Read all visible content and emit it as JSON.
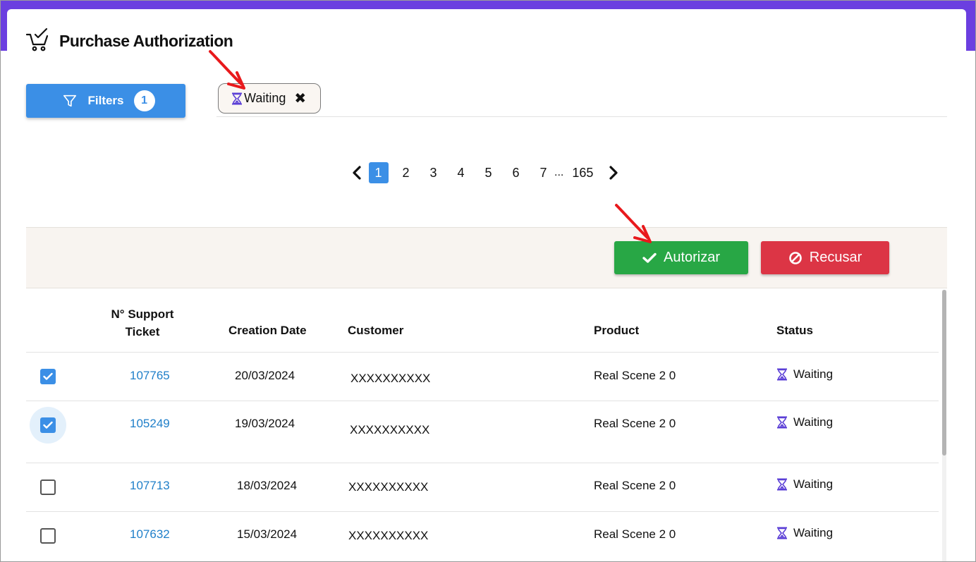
{
  "header": {
    "title": "Purchase Authorization",
    "icon": "cart-check-icon"
  },
  "filters": {
    "label": "Filters",
    "count": "1",
    "icon": "funnel-icon"
  },
  "active_filter_chip": {
    "label": "Waiting",
    "icon": "hourglass-icon",
    "close": "✖"
  },
  "pagination": {
    "pages": [
      "1",
      "2",
      "3",
      "4",
      "5",
      "6",
      "7"
    ],
    "active": "1",
    "ellipsis": "...",
    "last": "165"
  },
  "actions": {
    "authorize_label": "Autorizar",
    "refuse_label": "Recusar"
  },
  "table": {
    "columns": {
      "ticket_line1": "N° Support",
      "ticket_line2": "Ticket",
      "creation_date": "Creation Date",
      "customer": "Customer",
      "product": "Product",
      "status": "Status"
    },
    "rows": [
      {
        "checked": true,
        "ticket": "107765",
        "date": "20/03/2024",
        "customer": "XXXXXXXXXX",
        "product": "Real Scene 2 0",
        "status": "Waiting"
      },
      {
        "checked": true,
        "ticket": "105249",
        "date": "19/03/2024",
        "customer": "XXXXXXXXXX",
        "product": "Real Scene 2 0",
        "status": "Waiting"
      },
      {
        "checked": false,
        "ticket": "107713",
        "date": "18/03/2024",
        "customer": "XXXXXXXXXX",
        "product": "Real Scene 2 0",
        "status": "Waiting"
      },
      {
        "checked": false,
        "ticket": "107632",
        "date": "15/03/2024",
        "customer": "XXXXXXXXXX",
        "product": "Real Scene 2 0",
        "status": "Waiting"
      }
    ]
  },
  "colors": {
    "accent_purple": "#6b3fe0",
    "primary_blue": "#3b8fe6",
    "authorize_green": "#28a745",
    "refuse_red": "#dc3545",
    "annotation_red": "#e8191c"
  }
}
